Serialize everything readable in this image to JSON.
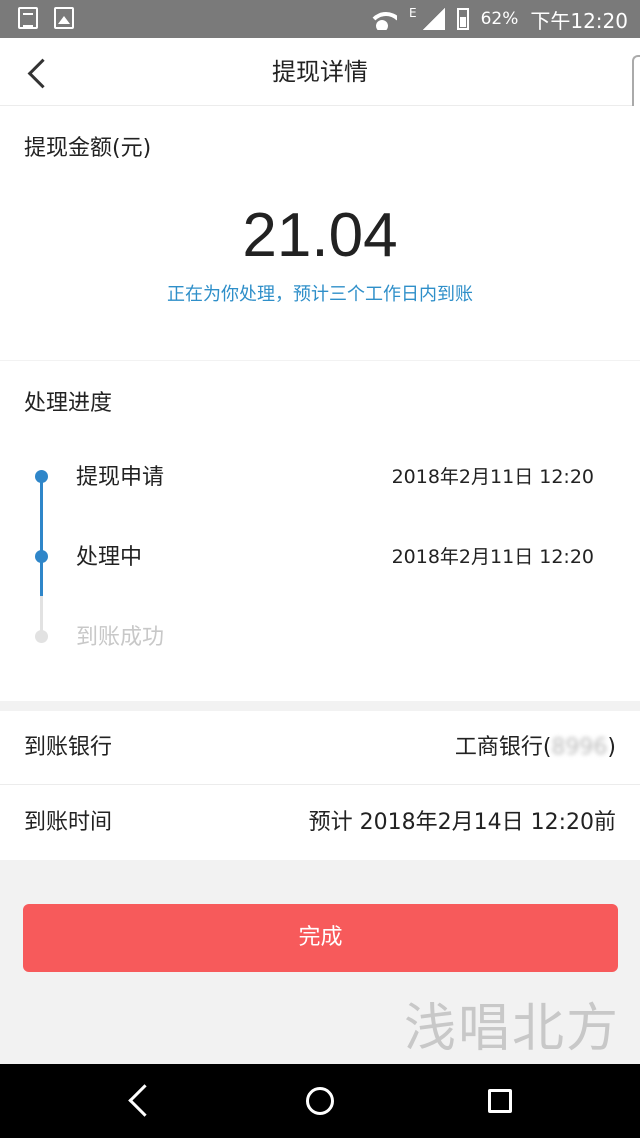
{
  "status_bar": {
    "network_type": "E",
    "battery_percent": "62%",
    "time": "下午12:20"
  },
  "header": {
    "title": "提现详情"
  },
  "amount": {
    "label": "提现金额(元)",
    "value": "21.04",
    "note": "正在为你处理，预计三个工作日内到账",
    "note_color": "#2f8fc9"
  },
  "progress": {
    "title": "处理进度",
    "active_color": "#2f86c9",
    "steps": [
      {
        "label": "提现申请",
        "time": "2018年2月11日 12:20",
        "state": "done"
      },
      {
        "label": "处理中",
        "time": "2018年2月11日 12:20",
        "state": "done"
      },
      {
        "label": "到账成功",
        "time": "",
        "state": "pending"
      }
    ]
  },
  "info": {
    "bank_label": "到账银行",
    "bank_name": "工商银行(",
    "bank_masked": "8996",
    "bank_close": ")",
    "time_label": "到账时间",
    "time_value": "预计 2018年2月14日 12:20前"
  },
  "actions": {
    "done_label": "完成",
    "done_color": "#f75a5b"
  },
  "watermark": "浅唱北方",
  "icons": {
    "status_left": [
      "notification-doc-icon",
      "notification-image-icon"
    ],
    "status_right": [
      "wifi-icon",
      "signal-icon",
      "battery-icon"
    ],
    "nav": [
      "nav-back-icon",
      "nav-home-icon",
      "nav-recent-icon"
    ]
  }
}
